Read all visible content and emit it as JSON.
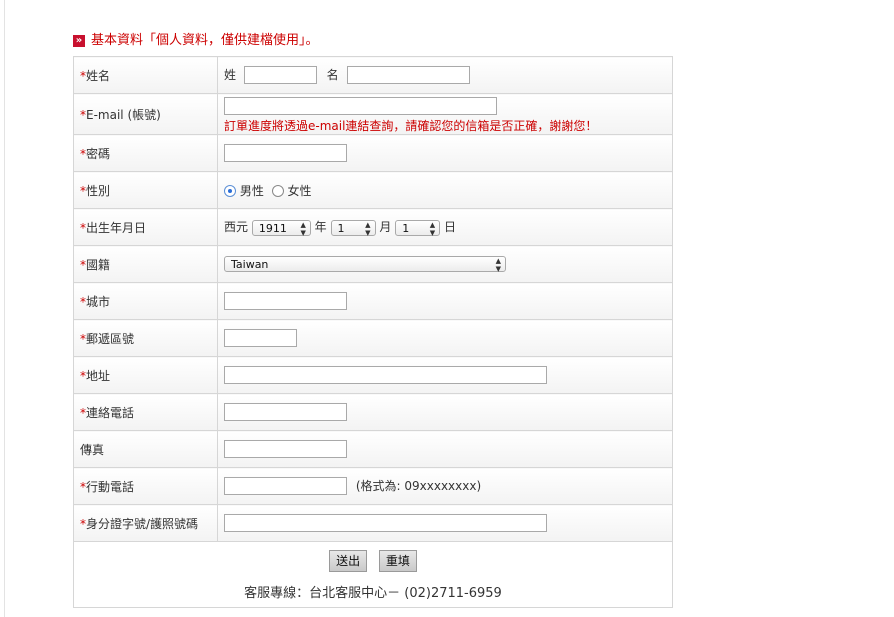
{
  "section": {
    "title": "基本資料「個人資料，僅供建檔使用」。",
    "marker": "»"
  },
  "req_mark": "*",
  "fields": {
    "name": {
      "label": "姓名",
      "last_label": "姓",
      "first_label": "名"
    },
    "email": {
      "label": "E-mail (帳號)",
      "note": "訂單進度將透過e-mail連結查詢，請確認您的信箱是否正確，謝謝您！"
    },
    "password": {
      "label": "密碼"
    },
    "gender": {
      "label": "性別",
      "male": "男性",
      "female": "女性",
      "selected": "male"
    },
    "birthday": {
      "label": "出生年月日",
      "prefix": "西元",
      "year": "1911",
      "year_unit": "年",
      "month": "1",
      "month_unit": "月",
      "day": "1",
      "day_unit": "日"
    },
    "nationality": {
      "label": "國籍",
      "value": "Taiwan"
    },
    "city": {
      "label": "城市"
    },
    "zip": {
      "label": "郵遞區號"
    },
    "address": {
      "label": "地址"
    },
    "phone": {
      "label": "連絡電話"
    },
    "fax": {
      "label": "傳真"
    },
    "mobile": {
      "label": "行動電話",
      "hint": "(格式為: 09xxxxxxxx)"
    },
    "id": {
      "label": "身分證字號/護照號碼"
    }
  },
  "actions": {
    "submit": "送出",
    "reset": "重填"
  },
  "footer": {
    "service": "客服專線：台北客服中心－ (02)2711-6959"
  },
  "icons": {
    "arrows": "updown-arrows-icon"
  }
}
